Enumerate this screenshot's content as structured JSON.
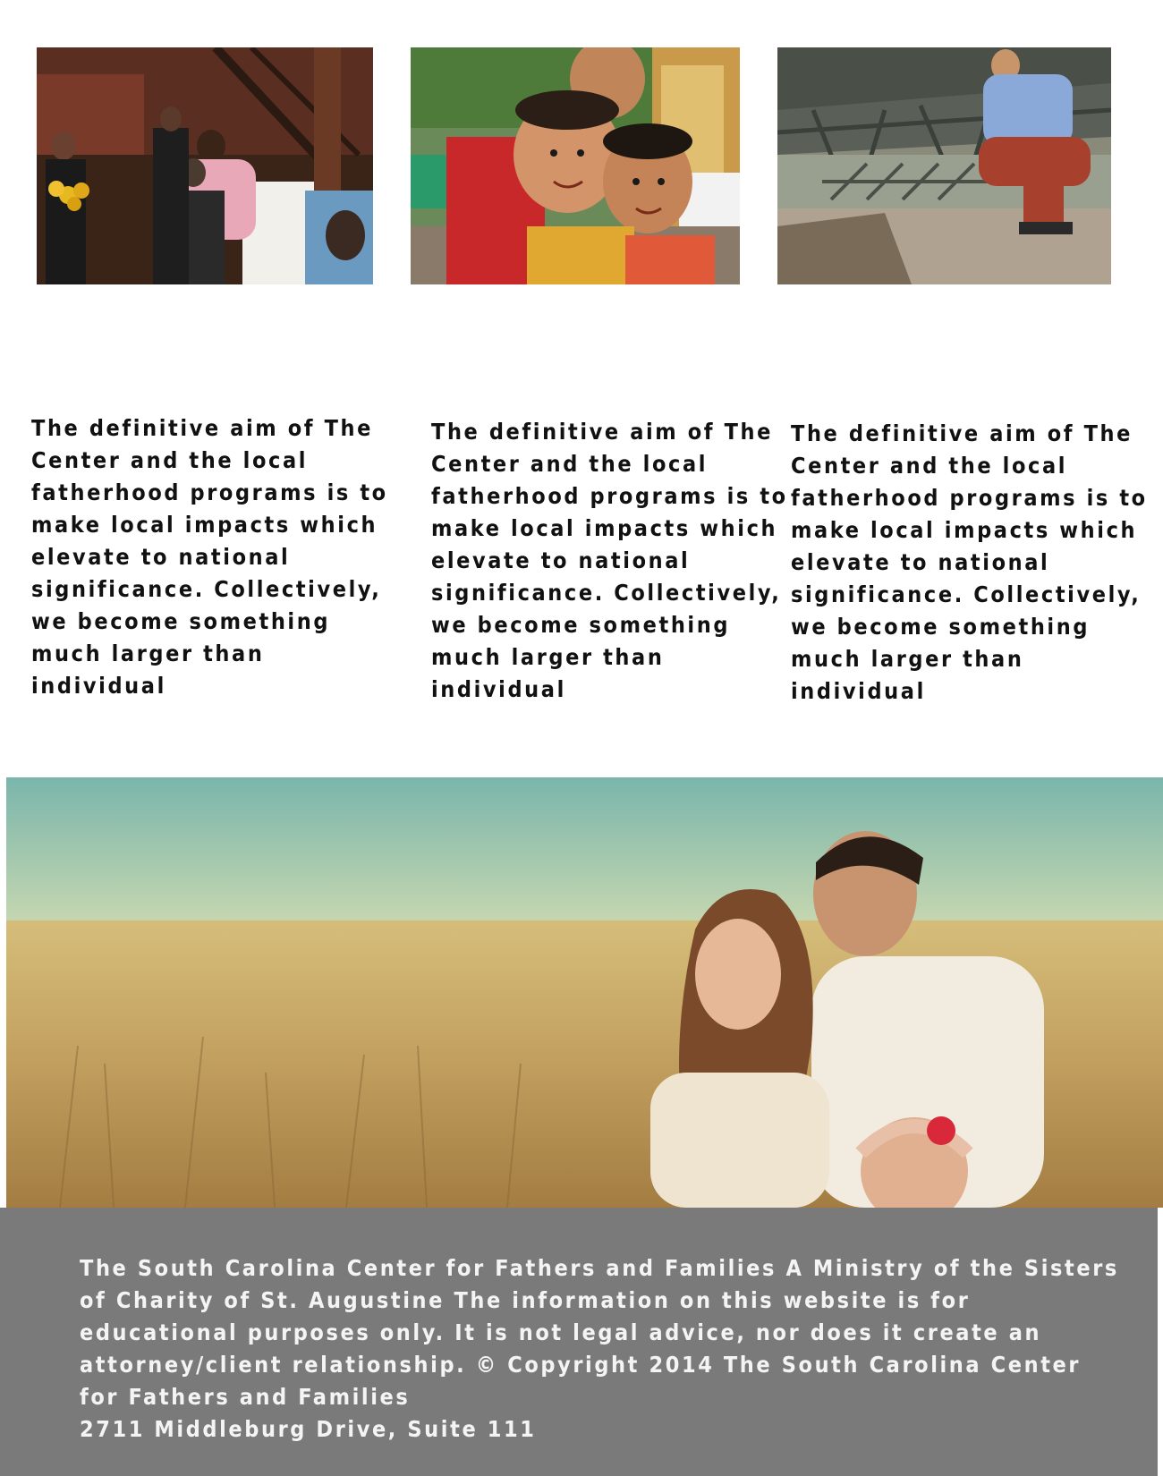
{
  "columns": [
    {
      "text": "The definitive aim of The Center and the local fatherhood programs is to make local impacts which elevate to national significance. Collectively, we become something much larger than individual"
    },
    {
      "text": "The definitive aim of The Center and the local fatherhood programs is to make local impacts which elevate to national significance. Collectively, we become something much larger than individual"
    },
    {
      "text": "The definitive aim of The Center and the local fatherhood programs is to make local impacts which elevate to national significance. Collectively, we become something much larger than individual"
    }
  ],
  "footer": {
    "text": "The South Carolina Center for Fathers and Families A Ministry of the Sisters of Charity of St. Augustine The information on this website is for educational purposes only. It is not legal advice, nor does it create an attorney/client relationship. © Copyright 2014 The South Carolina Center for Fathers and Families",
    "address": "2711 Middleburg Drive, Suite 111"
  },
  "colors": {
    "footer_bg": "#7a7a7a",
    "footer_text": "#f4f4f4",
    "body_text": "#111111"
  }
}
